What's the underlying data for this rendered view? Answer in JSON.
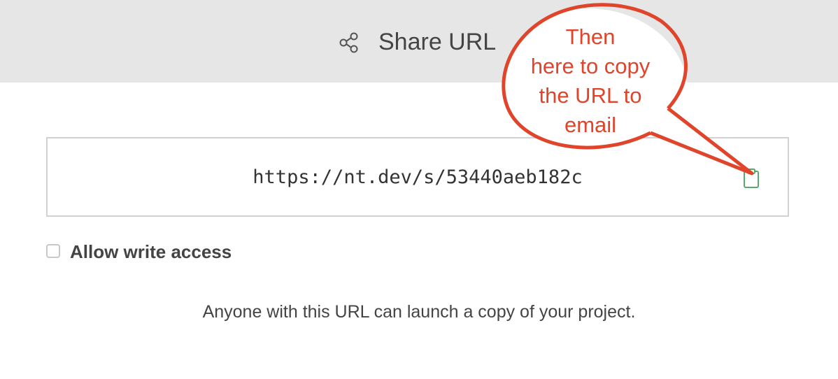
{
  "header": {
    "title": "Share URL",
    "icon": "share-icon"
  },
  "share": {
    "url": "https://nt.dev/s/53440aeb182c",
    "copy_icon": "clipboard-icon",
    "copy_icon_color": "#5aa96a"
  },
  "options": {
    "write_access_label": "Allow write access",
    "write_access_checked": false
  },
  "info_text": "Anyone with this URL can launch a copy of your project.",
  "annotation": {
    "lines": [
      "Then",
      "here to copy",
      "the URL to",
      "email"
    ],
    "color": "#e0452b"
  }
}
